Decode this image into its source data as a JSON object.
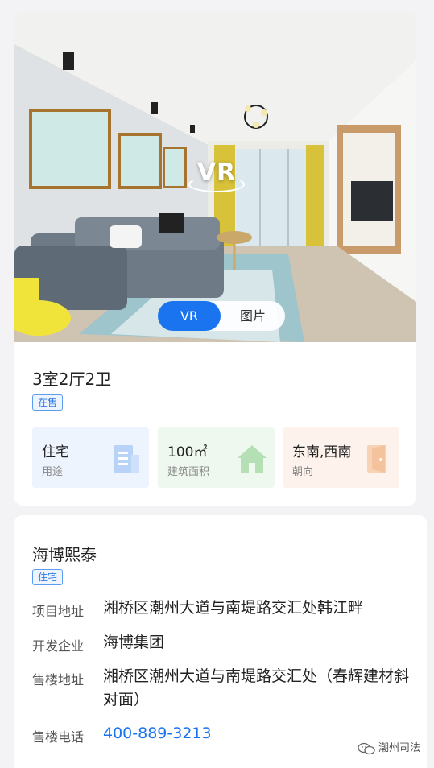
{
  "media": {
    "vr_badge": "VR",
    "toggle_options": [
      "VR",
      "图片"
    ]
  },
  "unit": {
    "layout": "3室2厅2卫",
    "status_tag": "在售",
    "facts": [
      {
        "value": "住宅",
        "label": "用途",
        "icon": "building-icon",
        "bg": "#eef4fd",
        "icon_color": "#b8d3f7"
      },
      {
        "value": "100㎡",
        "label": "建筑面积",
        "icon": "house-icon",
        "bg": "#eef8ee",
        "icon_color": "#b5e0b5"
      },
      {
        "value": "东南,西南",
        "label": "朝向",
        "icon": "door-icon",
        "bg": "#fdf3ec",
        "icon_color": "#f7d2b5"
      }
    ]
  },
  "project": {
    "name": "海博熙泰",
    "type_tag": "住宅",
    "rows": [
      {
        "label": "项目地址",
        "value": "湘桥区潮州大道与南堤路交汇处韩江畔"
      },
      {
        "label": "开发企业",
        "value": "海博集团"
      },
      {
        "label": "售楼地址",
        "value": "湘桥区潮州大道与南堤路交汇处（春辉建材斜对面）"
      },
      {
        "label": "售楼电话",
        "value": "400-889-3213"
      }
    ]
  },
  "watermark": {
    "text": "潮州司法",
    "icon": "wechat-icon"
  },
  "colors": {
    "accent": "#1a74f0",
    "tag_border": "#5b9cf2"
  }
}
